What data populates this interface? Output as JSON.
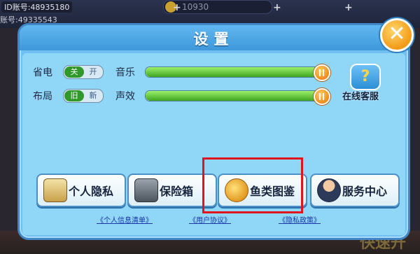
{
  "background": {
    "account_id": "ID账号:48935180",
    "account_id_2": "账号:49335543",
    "coins": "10930",
    "quick_start": "快速开"
  },
  "dialog": {
    "title": "设置",
    "close_label": "✕",
    "power_saving": {
      "label": "省电",
      "selected": "关",
      "other": "开"
    },
    "layout": {
      "label": "布局",
      "selected": "旧",
      "other": "新"
    },
    "music": {
      "label": "音乐",
      "level": 1.0
    },
    "sound_effects": {
      "label": "声效",
      "level": 1.0
    },
    "customer_service": {
      "label": "在线客服"
    },
    "buttons": [
      {
        "label": "个人隐私",
        "icon": "clipboard-icon"
      },
      {
        "label": "保险箱",
        "icon": "safe-icon"
      },
      {
        "label": "鱼类图鉴",
        "icon": "fish-icon"
      },
      {
        "label": "服务中心",
        "icon": "service-agent-icon"
      }
    ],
    "links": [
      "《个人信息清单》",
      "《用户协议》",
      "《隐私政策》"
    ],
    "accent_colors": {
      "slider_fill": "#3ea522",
      "toggle_on": "#2f9a2a",
      "highlight_box": "#e0151b"
    }
  }
}
